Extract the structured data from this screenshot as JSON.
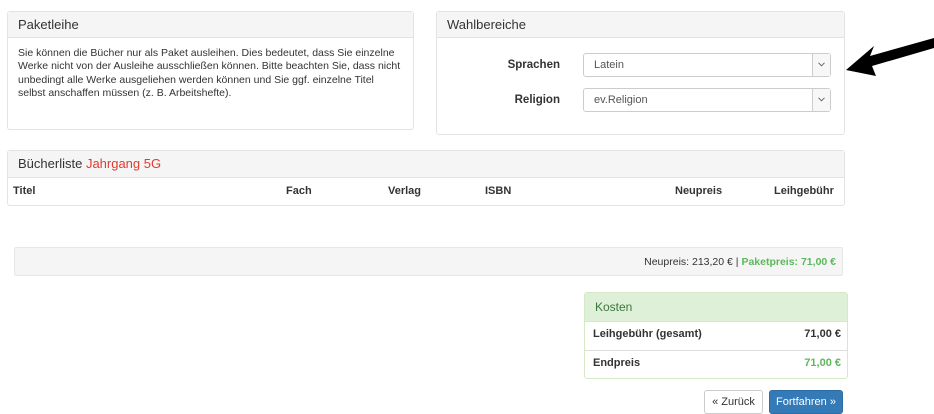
{
  "paketleihe": {
    "title": "Paketleihe",
    "text": "Sie können die Bücher nur als Paket ausleihen. Dies bedeutet, dass Sie einzelne Werke nicht von der Ausleihe ausschließen können. Bitte beachten Sie, dass nicht unbedingt alle Werke ausgeliehen werden können und Sie ggf. einzelne Titel selbst anschaffen müssen (z. B. Arbeitshefte)."
  },
  "wahlbereiche": {
    "title": "Wahlbereiche",
    "fields": [
      {
        "label": "Sprachen",
        "value": "Latein"
      },
      {
        "label": "Religion",
        "value": "ev.Religion"
      }
    ]
  },
  "buecherliste": {
    "title": "Bücherliste",
    "highlight": "Jahrgang 5G",
    "columns": [
      "Titel",
      "Fach",
      "Verlag",
      "ISBN",
      "Neupreis",
      "Leihgebühr"
    ]
  },
  "summary": {
    "neupreis": "Neupreis: 213,20 €",
    "separator": "|",
    "paketpreis": "Paketpreis: 71,00 €"
  },
  "kosten": {
    "title": "Kosten",
    "rows": [
      {
        "label": "Leihgebühr (gesamt)",
        "value": "71,00 €"
      },
      {
        "label": "Endpreis",
        "value": "71,00 €"
      }
    ]
  },
  "buttons": {
    "back": "« Zurück",
    "next": "Fortfahren »"
  },
  "colors": {
    "accent_red": "#e23b2e",
    "green": "#5cb85c",
    "primary": "#337ab7"
  }
}
